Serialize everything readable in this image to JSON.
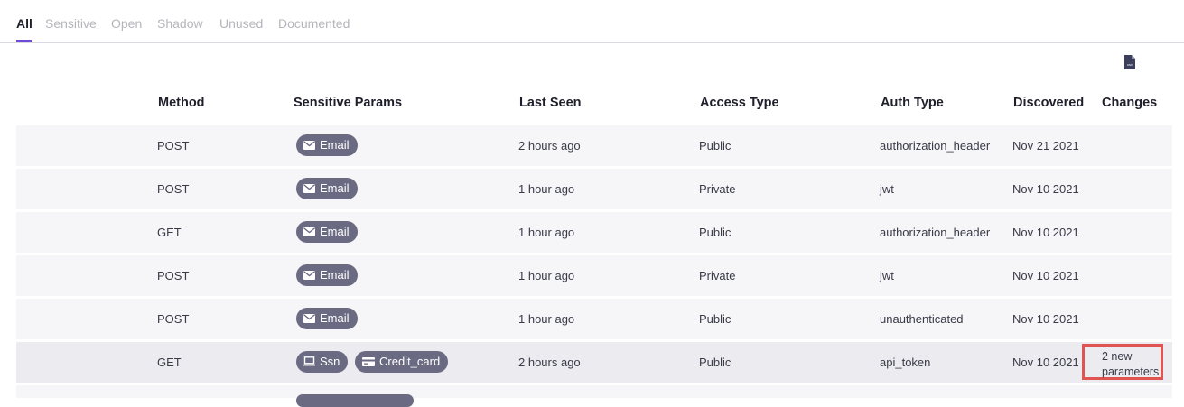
{
  "tabs": [
    {
      "label": "All",
      "active": true
    },
    {
      "label": "Sensitive",
      "active": false
    },
    {
      "label": "Open",
      "active": false
    },
    {
      "label": "Shadow",
      "active": false
    },
    {
      "label": "Unused",
      "active": false
    },
    {
      "label": "Documented",
      "active": false
    }
  ],
  "toolbar": {
    "export_icon": "csv-file-icon"
  },
  "table": {
    "columns": [
      "Method",
      "Sensitive Params",
      "Last Seen",
      "Access Type",
      "Auth Type",
      "Discovered",
      "Changes"
    ],
    "rows": [
      {
        "method": "POST",
        "params": [
          {
            "label": "Email",
            "icon": "envelope-icon"
          }
        ],
        "last_seen": "2 hours ago",
        "access": "Public",
        "auth": "authorization_header",
        "discovered": "Nov 21 2021",
        "changes": ""
      },
      {
        "method": "POST",
        "params": [
          {
            "label": "Email",
            "icon": "envelope-icon"
          }
        ],
        "last_seen": "1 hour ago",
        "access": "Private",
        "auth": "jwt",
        "discovered": "Nov 10 2021",
        "changes": ""
      },
      {
        "method": "GET",
        "params": [
          {
            "label": "Email",
            "icon": "envelope-icon"
          }
        ],
        "last_seen": "1 hour ago",
        "access": "Public",
        "auth": "authorization_header",
        "discovered": "Nov 10 2021",
        "changes": ""
      },
      {
        "method": "POST",
        "params": [
          {
            "label": "Email",
            "icon": "envelope-icon"
          }
        ],
        "last_seen": "1 hour ago",
        "access": "Private",
        "auth": "jwt",
        "discovered": "Nov 10 2021",
        "changes": ""
      },
      {
        "method": "POST",
        "params": [
          {
            "label": "Email",
            "icon": "envelope-icon"
          }
        ],
        "last_seen": "1 hour ago",
        "access": "Public",
        "auth": "unauthenticated",
        "discovered": "Nov 10 2021",
        "changes": ""
      },
      {
        "method": "GET",
        "params": [
          {
            "label": "Ssn",
            "icon": "laptop-icon"
          },
          {
            "label": "Credit_card",
            "icon": "credit-card-icon"
          }
        ],
        "last_seen": "2 hours ago",
        "access": "Public",
        "auth": "api_token",
        "discovered": "Nov 10 2021",
        "changes_line1": "2 new",
        "changes_line2": "parameters",
        "highlighted": true
      }
    ]
  },
  "colors": {
    "accent": "#6c4bd8",
    "chip": "#6a6a82",
    "highlight_border": "#e05552",
    "row_bg": "#f6f6f8",
    "row_hl_bg": "#ececf0"
  }
}
